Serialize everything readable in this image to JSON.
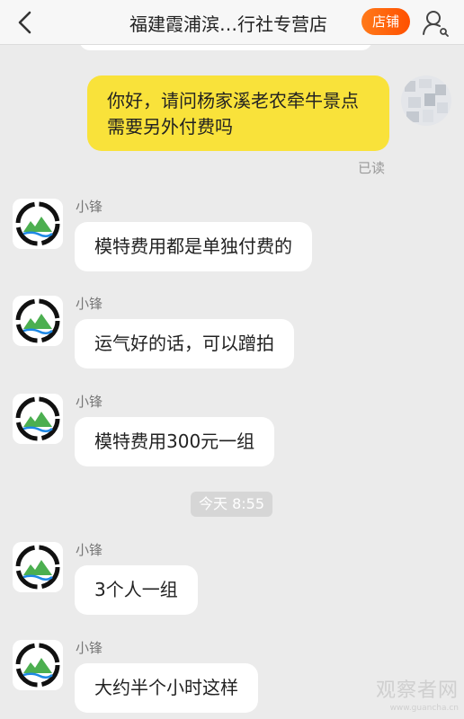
{
  "header": {
    "title": "福建霞浦滨…行社专营店",
    "shop_button": "店铺"
  },
  "messages_outgoing": [
    {
      "text": "你好，请问杨家溪老农牵牛景点需要另外付费吗",
      "status": "已读"
    }
  ],
  "messages_incoming": [
    {
      "sender": "小锋",
      "text": "模特费用都是单独付费的"
    },
    {
      "sender": "小锋",
      "text": "运气好的话，可以蹭拍"
    },
    {
      "sender": "小锋",
      "text": "模特费用300元一组"
    },
    {
      "sender": "小锋",
      "text": "3个人一组"
    },
    {
      "sender": "小锋",
      "text": "大约半个小时这样"
    }
  ],
  "timestamp": "今天 8:55",
  "watermark": {
    "main": "观察者网",
    "sub": "www.guancha.cn"
  },
  "colors": {
    "outgoing_bubble": "#f9e23a",
    "shop_button": "#ff5000",
    "background": "#ebebeb"
  }
}
